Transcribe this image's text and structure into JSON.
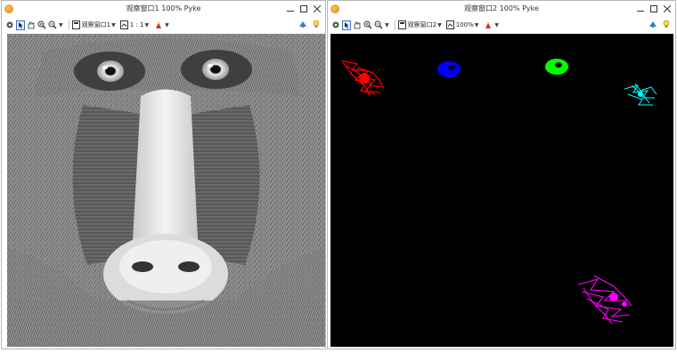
{
  "left_window": {
    "title": "观察窗口1  100%  Pyke",
    "toolbar": {
      "window_dropdown_label": "观察窗口1",
      "zoom_label": "1 : 1"
    }
  },
  "right_window": {
    "title": "观察窗口2  100%  Pyke",
    "toolbar": {
      "window_dropdown_label": "观察窗口2",
      "zoom_label": "100%"
    }
  },
  "icons": {
    "app": "app-logo-icon",
    "minimize": "minimize-icon",
    "maximize": "maximize-icon",
    "close": "close-icon",
    "toolbar": [
      "settings-icon",
      "pointer-icon",
      "pan-icon",
      "zoom-in-icon",
      "zoom-out-icon",
      "image-icon",
      "paint-icon",
      "help-icon",
      "lightbulb-icon"
    ]
  },
  "colors": {
    "red_region": "#ff0000",
    "blue_region": "#0000ff",
    "green_region": "#00ff00",
    "cyan_region": "#00ffff",
    "magenta_region": "#ff00ff"
  }
}
